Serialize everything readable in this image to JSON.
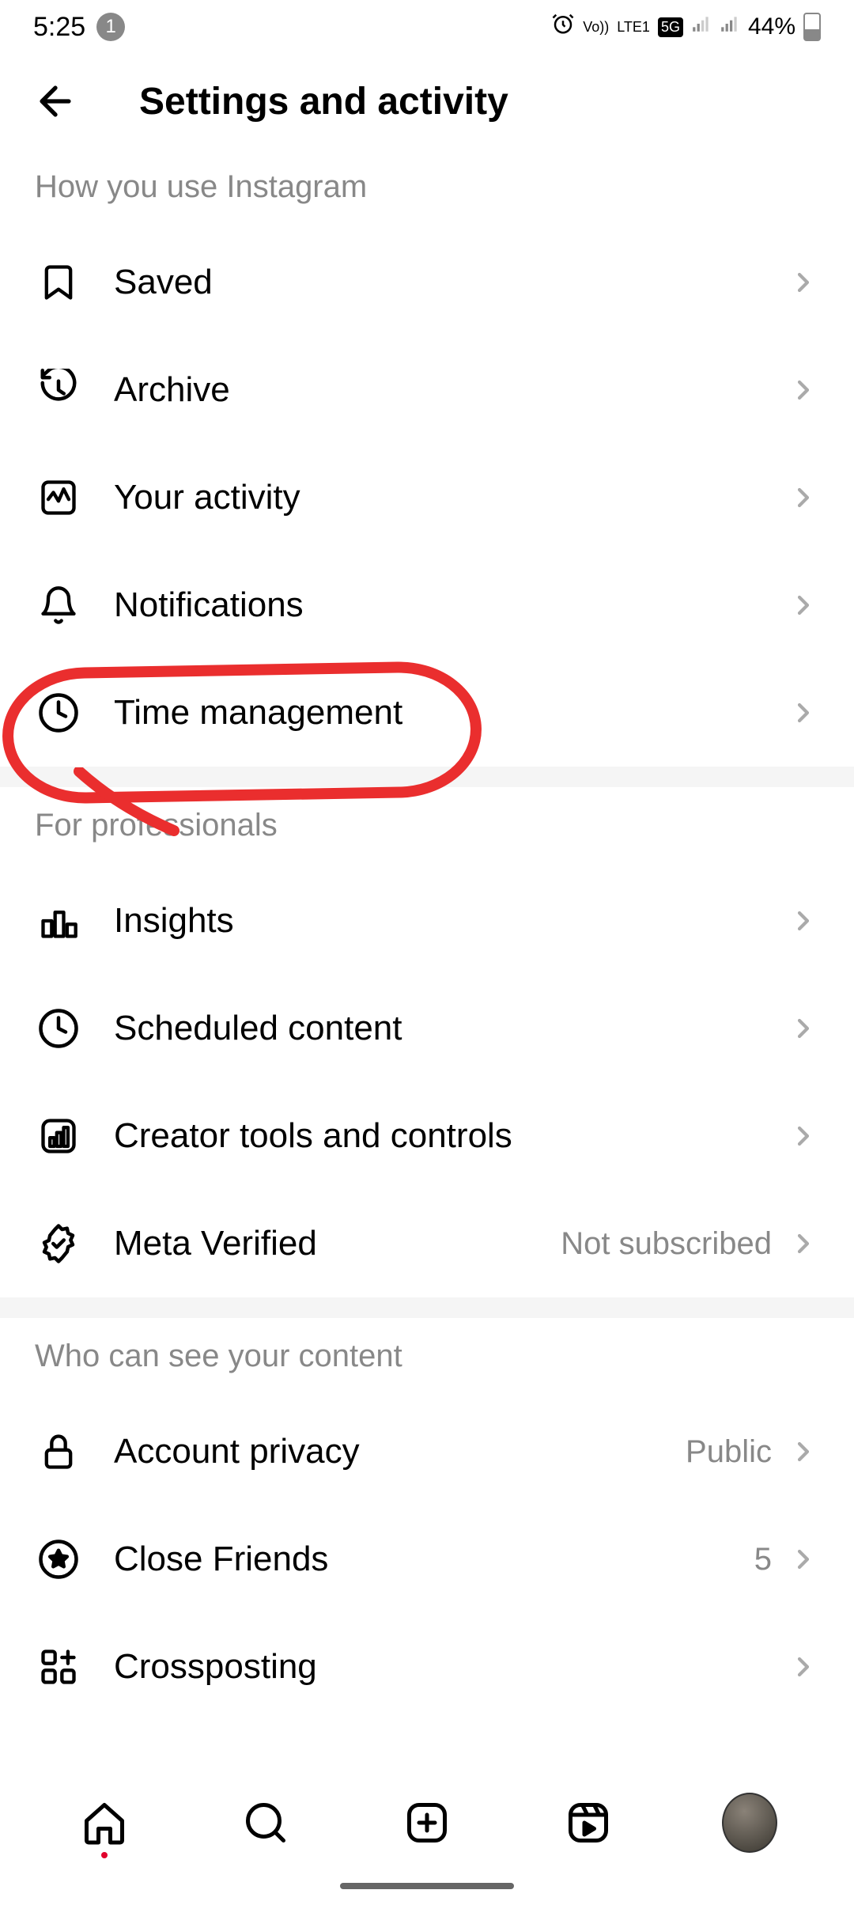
{
  "status": {
    "time": "5:25",
    "notif_count": "1",
    "battery": "44%",
    "signal_label": "LTE1",
    "network_badge": "5G",
    "volte": "Vo))"
  },
  "header": {
    "title": "Settings and activity"
  },
  "sections": {
    "s1_title": "How you use Instagram",
    "s2_title": "For professionals",
    "s3_title": "Who can see your content"
  },
  "rows": {
    "saved": "Saved",
    "archive": "Archive",
    "activity": "Your activity",
    "notifications": "Notifications",
    "time_mgmt": "Time management",
    "insights": "Insights",
    "scheduled": "Scheduled content",
    "creator": "Creator tools and controls",
    "meta": "Meta Verified",
    "meta_value": "Not subscribed",
    "privacy": "Account privacy",
    "privacy_value": "Public",
    "close_friends": "Close Friends",
    "close_friends_value": "5",
    "crosspost": "Crossposting"
  }
}
